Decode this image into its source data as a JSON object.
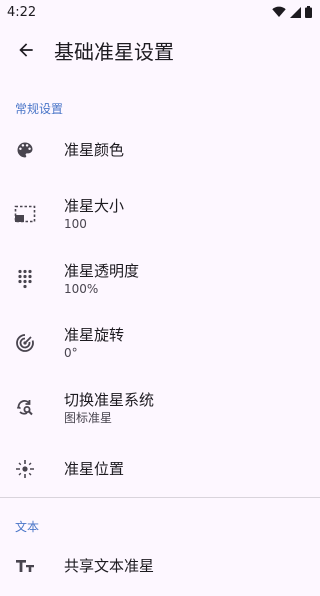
{
  "status_bar": {
    "time": "4:22"
  },
  "app_bar": {
    "title": "基础准星设置"
  },
  "sections": [
    {
      "header": "常规设置",
      "items": [
        {
          "label": "准星颜色",
          "icon": "palette-icon"
        },
        {
          "label": "准星大小",
          "value": "100",
          "icon": "resize-icon"
        },
        {
          "label": "准星透明度",
          "value": "100%",
          "icon": "dots-grid-icon"
        },
        {
          "label": "准星旋转",
          "value": "0°",
          "icon": "rotate-icon"
        },
        {
          "label": "切换准星系统",
          "value": "图标准星",
          "icon": "switch-search-icon"
        },
        {
          "label": "准星位置",
          "icon": "crosshair-position-icon"
        }
      ]
    },
    {
      "header": "文本",
      "items": [
        {
          "label": "共享文本准星",
          "icon": "text-icon"
        }
      ]
    }
  ]
}
